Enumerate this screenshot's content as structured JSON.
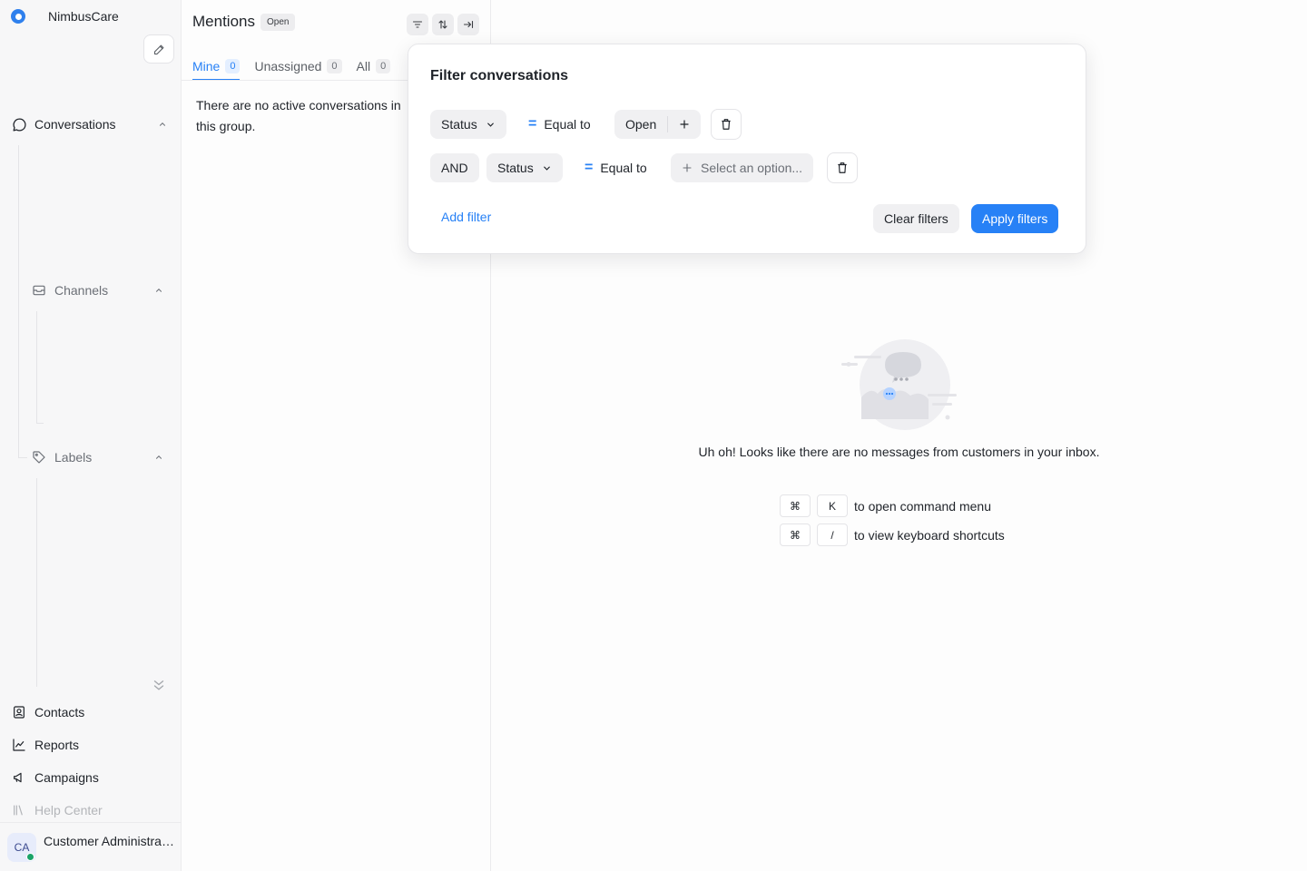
{
  "app": {
    "name": "NimbusCare"
  },
  "sidebar": {
    "conversations_label": "Conversations",
    "channels_label": "Channels",
    "labels_label": "Labels",
    "items": [
      {
        "label": "Contacts",
        "icon": "contacts-icon"
      },
      {
        "label": "Reports",
        "icon": "reports-icon"
      },
      {
        "label": "Campaigns",
        "icon": "campaigns-icon"
      },
      {
        "label": "Help Center",
        "icon": "help-center-icon"
      }
    ],
    "user": {
      "initials": "CA",
      "name": "Customer Administrator",
      "status_color": "#1aa369"
    }
  },
  "list": {
    "title": "Mentions",
    "status_badge": "Open",
    "tabs": [
      {
        "label": "Mine",
        "count": "0"
      },
      {
        "label": "Unassigned",
        "count": "0"
      },
      {
        "label": "All",
        "count": "0"
      }
    ],
    "empty_text": "There are no active conversations in this group."
  },
  "main": {
    "empty_message": "Uh oh! Looks like there are no messages from customers in your inbox.",
    "shortcuts": [
      {
        "keys": [
          "⌘",
          "K"
        ],
        "text": "to open command menu"
      },
      {
        "keys": [
          "⌘",
          "/"
        ],
        "text": "to view keyboard shortcuts"
      }
    ]
  },
  "filter_popover": {
    "title": "Filter conversations",
    "row1": {
      "attribute": "Status",
      "operator": "Equal to",
      "value": "Open"
    },
    "row2": {
      "conjunction": "AND",
      "attribute": "Status",
      "operator": "Equal to",
      "placeholder": "Select an option..."
    },
    "add_filter": "Add filter",
    "clear_filters": "Clear filters",
    "apply_filters": "Apply filters"
  },
  "colors": {
    "accent": "#2781f6",
    "sidebar_bg": "#f7f7f8"
  }
}
